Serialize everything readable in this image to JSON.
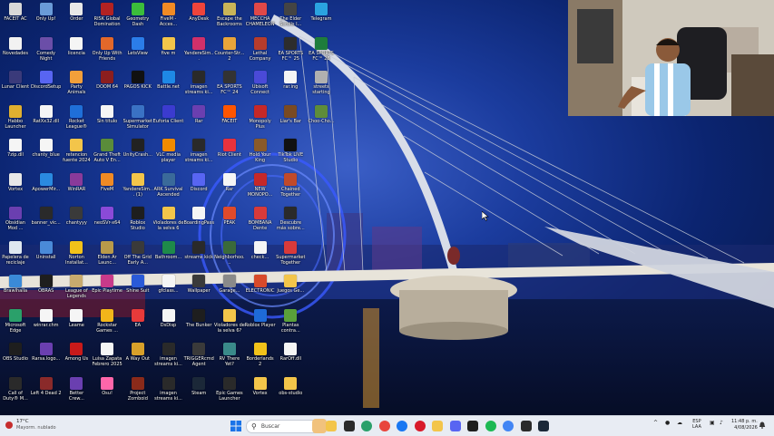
{
  "desktop": {
    "icons": [
      {
        "label": "FACEIT AC",
        "icon": "faceit-ac-icon",
        "color": "#d8d8d8",
        "col": 0,
        "row": 0
      },
      {
        "label": "Only Up!",
        "icon": "only-up-icon",
        "color": "#6a9bd8",
        "col": 1,
        "row": 0
      },
      {
        "label": "Order",
        "icon": "order-icon",
        "color": "#e8e8e8",
        "col": 2,
        "row": 0
      },
      {
        "label": "RISK Global Domination",
        "icon": "risk-icon",
        "color": "#b22222",
        "col": 3,
        "row": 0
      },
      {
        "label": "Geometry Dash",
        "icon": "geometry-dash-icon",
        "color": "#3bbd3b",
        "col": 4,
        "row": 0
      },
      {
        "label": "FiveM - Acces...",
        "icon": "fivem-icon",
        "color": "#f08a24",
        "col": 5,
        "row": 0
      },
      {
        "label": "AnyDesk",
        "icon": "anydesk-icon",
        "color": "#ef443b",
        "col": 6,
        "row": 0
      },
      {
        "label": "Escape the Backrooms",
        "icon": "backrooms-icon",
        "color": "#c9b458",
        "col": 7,
        "row": 0
      },
      {
        "label": "MECCHA CHAMELEON",
        "icon": "meccha-icon",
        "color": "#e04848",
        "col": 8,
        "row": 0
      },
      {
        "label": "The Elder Scrolls I...",
        "icon": "elder-scrolls-icon",
        "color": "#444444",
        "col": 9,
        "row": 0
      },
      {
        "label": "Telegram",
        "icon": "telegram-icon",
        "color": "#2aa3e0",
        "col": 10,
        "row": 0
      },
      {
        "label": "Novedades",
        "icon": "novedades-icon",
        "color": "#f2f2f2",
        "col": 0,
        "row": 1
      },
      {
        "label": "Comedy Night",
        "icon": "comedy-night-icon",
        "color": "#6b4ea8",
        "col": 1,
        "row": 1
      },
      {
        "label": "licencia",
        "icon": "file-icon",
        "color": "#f5f5f5",
        "col": 2,
        "row": 1
      },
      {
        "label": "Only Up With Friends",
        "icon": "only-up-friends-icon",
        "color": "#e3682a",
        "col": 3,
        "row": 1
      },
      {
        "label": "LetsView",
        "icon": "letsview-icon",
        "color": "#2b7de9",
        "col": 4,
        "row": 1
      },
      {
        "label": "five m",
        "icon": "folder-icon",
        "color": "#f3c54a",
        "col": 5,
        "row": 1
      },
      {
        "label": "YandereSim...",
        "icon": "yandere-icon",
        "color": "#d0306a",
        "col": 6,
        "row": 1
      },
      {
        "label": "Counter-Str... 2",
        "icon": "cs2-icon",
        "color": "#e8a43a",
        "col": 7,
        "row": 1
      },
      {
        "label": "Lethal Company",
        "icon": "lethal-company-icon",
        "color": "#b63c2c",
        "col": 8,
        "row": 1
      },
      {
        "label": "EA SPORTS FC™ 25",
        "icon": "eafc-icon",
        "color": "#2d2d2d",
        "col": 9,
        "row": 1
      },
      {
        "label": "EA SPORTS FC™ 25",
        "icon": "eafc-icon",
        "color": "#1e7d3c",
        "col": 10,
        "row": 1
      },
      {
        "label": "Lunar Client",
        "icon": "lunar-client-icon",
        "color": "#3a3a7a",
        "col": 0,
        "row": 2
      },
      {
        "label": "DiscordSetup",
        "icon": "discord-icon",
        "color": "#5865f2",
        "col": 1,
        "row": 2
      },
      {
        "label": "Party Animals",
        "icon": "party-animals-icon",
        "color": "#f29f3a",
        "col": 2,
        "row": 2
      },
      {
        "label": "DOOM 64",
        "icon": "doom-icon",
        "color": "#8b1e1e",
        "col": 3,
        "row": 2
      },
      {
        "label": "PAGOS KICK",
        "icon": "pagos-kick-icon",
        "color": "#111111",
        "col": 4,
        "row": 2
      },
      {
        "label": "Battle.net",
        "icon": "battlenet-icon",
        "color": "#1e88e5",
        "col": 5,
        "row": 2
      },
      {
        "label": "imagen streams ki...",
        "icon": "image-icon",
        "color": "#2a2a2a",
        "col": 6,
        "row": 2
      },
      {
        "label": "EA SPORTS FC™ 24",
        "icon": "eafc-icon",
        "color": "#333333",
        "col": 7,
        "row": 2
      },
      {
        "label": "Ubisoft Connect",
        "icon": "ubisoft-icon",
        "color": "#4a4ad8",
        "col": 8,
        "row": 2
      },
      {
        "label": "rar.ing",
        "icon": "file-icon",
        "color": "#f5f5f5",
        "col": 9,
        "row": 2
      },
      {
        "label": "streets starting",
        "icon": "streets-icon",
        "color": "#b0b0b0",
        "col": 10,
        "row": 2
      },
      {
        "label": "Habbo Launcher",
        "icon": "habbo-icon",
        "color": "#e0b030",
        "col": 0,
        "row": 3
      },
      {
        "label": "RatXx32.dll",
        "icon": "dll-icon",
        "color": "#f5f5f5",
        "col": 1,
        "row": 3
      },
      {
        "label": "Rocket League®",
        "icon": "rocket-league-icon",
        "color": "#1f6fd8",
        "col": 2,
        "row": 3
      },
      {
        "label": "Sin título",
        "icon": "file-icon",
        "color": "#f5f5f5",
        "col": 3,
        "row": 3
      },
      {
        "label": "Supermarket Simulator",
        "icon": "supermarket-icon",
        "color": "#3a72c4",
        "col": 4,
        "row": 3
      },
      {
        "label": "Euforia Client",
        "icon": "euforia-icon",
        "color": "#3b3bcf",
        "col": 5,
        "row": 3
      },
      {
        "label": "Rar",
        "icon": "rar-icon",
        "color": "#6a3fb0",
        "col": 6,
        "row": 3
      },
      {
        "label": "FACEIT",
        "icon": "faceit-icon",
        "color": "#ff5500",
        "col": 7,
        "row": 3
      },
      {
        "label": "Monopoly Plus",
        "icon": "monopoly-icon",
        "color": "#c62828",
        "col": 8,
        "row": 3
      },
      {
        "label": "Liar's Bar",
        "icon": "liars-bar-icon",
        "color": "#7a4a22",
        "col": 9,
        "row": 3
      },
      {
        "label": "Choo-Cho...",
        "icon": "choo-choo-icon",
        "color": "#5e8c3a",
        "col": 10,
        "row": 3
      },
      {
        "label": "7zip.dll",
        "icon": "dll-icon",
        "color": "#f5f5f5",
        "col": 0,
        "row": 4
      },
      {
        "label": "chanty_blue",
        "icon": "file-icon",
        "color": "#f5f5f5",
        "col": 1,
        "row": 4
      },
      {
        "label": "retencion fuente 2024",
        "icon": "folder-icon",
        "color": "#f3c54a",
        "col": 2,
        "row": 4
      },
      {
        "label": "Grand Theft Auto V En...",
        "icon": "gta-icon",
        "color": "#5a8c3a",
        "col": 3,
        "row": 4
      },
      {
        "label": "UnityCrash...",
        "icon": "unity-icon",
        "color": "#222222",
        "col": 4,
        "row": 4
      },
      {
        "label": "VLC media player",
        "icon": "vlc-icon",
        "color": "#f08a00",
        "col": 5,
        "row": 4
      },
      {
        "label": "imagen streams ki...",
        "icon": "image-icon",
        "color": "#2a2a2a",
        "col": 6,
        "row": 4
      },
      {
        "label": "Riot Client",
        "icon": "riot-icon",
        "color": "#e8323c",
        "col": 7,
        "row": 4
      },
      {
        "label": "Hold Your King",
        "icon": "hold-your-king-icon",
        "color": "#8a5a2a",
        "col": 8,
        "row": 4
      },
      {
        "label": "TikTok LIVE Studio",
        "icon": "tiktok-icon",
        "color": "#111111",
        "col": 9,
        "row": 4
      },
      {
        "label": "Vortex",
        "icon": "vortex-icon",
        "color": "#e8e8e8",
        "col": 0,
        "row": 5
      },
      {
        "label": "ApowerMir...",
        "icon": "apowermirror-icon",
        "color": "#2a8ae0",
        "col": 1,
        "row": 5
      },
      {
        "label": "WinRAR",
        "icon": "winrar-icon",
        "color": "#8a3a9a",
        "col": 2,
        "row": 5
      },
      {
        "label": "FiveM",
        "icon": "fivem-icon",
        "color": "#f08a24",
        "col": 3,
        "row": 5
      },
      {
        "label": "YandereSim... (1)",
        "icon": "folder-icon",
        "color": "#f3c54a",
        "col": 4,
        "row": 5
      },
      {
        "label": "ARK Survival Ascended",
        "icon": "ark-icon",
        "color": "#3a6a9a",
        "col": 5,
        "row": 5
      },
      {
        "label": "Discord",
        "icon": "discord-icon",
        "color": "#5865f2",
        "col": 6,
        "row": 5
      },
      {
        "label": "Rar",
        "icon": "file-icon",
        "color": "#f5f5f5",
        "col": 7,
        "row": 5
      },
      {
        "label": "NEW MONOPO...",
        "icon": "monopoly-icon",
        "color": "#c62828",
        "col": 8,
        "row": 5
      },
      {
        "label": "Chained Together",
        "icon": "chained-together-icon",
        "color": "#c04a2a",
        "col": 9,
        "row": 5
      },
      {
        "label": "Obsidian Mod ...",
        "icon": "obsidian-icon",
        "color": "#6a3fb0",
        "col": 0,
        "row": 6
      },
      {
        "label": "banner_vic...",
        "icon": "image-icon",
        "color": "#2a2a2a",
        "col": 1,
        "row": 6
      },
      {
        "label": "chantyyy",
        "icon": "image-icon",
        "color": "#3a3a3a",
        "col": 2,
        "row": 6
      },
      {
        "label": "neoSVr-x64",
        "icon": "neosvr-icon",
        "color": "#8a4ad8",
        "col": 3,
        "row": 6
      },
      {
        "label": "Roblox Studio",
        "icon": "roblox-studio-icon",
        "color": "#1e1e1e",
        "col": 4,
        "row": 6
      },
      {
        "label": "Violadores de la selva 6",
        "icon": "folder-icon",
        "color": "#f3c54a",
        "col": 5,
        "row": 6
      },
      {
        "label": "BoardingPass",
        "icon": "file-icon",
        "color": "#f5f5f5",
        "col": 6,
        "row": 6
      },
      {
        "label": "PEAK",
        "icon": "peak-icon",
        "color": "#e04a2a",
        "col": 7,
        "row": 6
      },
      {
        "label": "BOMBANA Dente",
        "icon": "bombana-icon",
        "color": "#d83a3a",
        "col": 8,
        "row": 6
      },
      {
        "label": "Descubre más sobre...",
        "icon": "spotlight-icon",
        "color": "#2a2a2a",
        "col": 9,
        "row": 6
      },
      {
        "label": "Papelera de reciclaje",
        "icon": "recycle-bin-icon",
        "color": "#dfe8f0",
        "col": 0,
        "row": 7
      },
      {
        "label": "Uninstall",
        "icon": "uninstall-icon",
        "color": "#4a8ad8",
        "col": 1,
        "row": 7
      },
      {
        "label": "Norton Installat...",
        "icon": "norton-icon",
        "color": "#f2c21a",
        "col": 2,
        "row": 7
      },
      {
        "label": "Elden Ar Launc...",
        "icon": "elden-ring-icon",
        "color": "#b89a4a",
        "col": 3,
        "row": 7
      },
      {
        "label": "Off The Grid Early A...",
        "icon": "off-the-grid-icon",
        "color": "#3a3a3a",
        "col": 4,
        "row": 7
      },
      {
        "label": "Bathroom...",
        "icon": "bathroom-icon",
        "color": "#1e8a4a",
        "col": 5,
        "row": 7
      },
      {
        "label": "streams kick",
        "icon": "image-icon",
        "color": "#2a2a2a",
        "col": 6,
        "row": 7
      },
      {
        "label": "Neighborhoo...",
        "icon": "neighborhood-icon",
        "color": "#3a6a3a",
        "col": 7,
        "row": 7
      },
      {
        "label": "check...",
        "icon": "file-icon",
        "color": "#f5f5f5",
        "col": 8,
        "row": 7
      },
      {
        "label": "Supermarket Together",
        "icon": "supermarket-together-icon",
        "color": "#d83a3a",
        "col": 9,
        "row": 7
      },
      {
        "label": "Brawlhalla",
        "icon": "brawlhalla-icon",
        "color": "#3a8ad8",
        "col": 0,
        "row": 8
      },
      {
        "label": "OBRAS",
        "icon": "obs-icon",
        "color": "#1e1e1e",
        "col": 1,
        "row": 8
      },
      {
        "label": "League of Legends",
        "icon": "league-icon",
        "color": "#c8aa6e",
        "col": 2,
        "row": 8
      },
      {
        "label": "Epic Playtime",
        "icon": "epic-playtime-icon",
        "color": "#c83a8a",
        "col": 3,
        "row": 8
      },
      {
        "label": "Shine Suit",
        "icon": "shine-suit-icon",
        "color": "#2a5ad8",
        "col": 4,
        "row": 8
      },
      {
        "label": "gfclass...",
        "icon": "file-icon",
        "color": "#f5f5f5",
        "col": 5,
        "row": 8
      },
      {
        "label": "Wallpaper",
        "icon": "image-icon",
        "color": "#3a3a3a",
        "col": 6,
        "row": 8
      },
      {
        "label": "Garage...",
        "icon": "garage-icon",
        "color": "#8a8a8a",
        "col": 7,
        "row": 8
      },
      {
        "label": "ELECTRONIC",
        "icon": "electronic-icon",
        "color": "#d84a2a",
        "col": 8,
        "row": 8
      },
      {
        "label": "Juegos Ge...",
        "icon": "folder-icon",
        "color": "#f3c54a",
        "col": 9,
        "row": 8
      },
      {
        "label": "Microsoft Edge",
        "icon": "edge-icon",
        "color": "#2aa06a",
        "col": 0,
        "row": 9
      },
      {
        "label": "winrar.chm",
        "icon": "file-icon",
        "color": "#f5f5f5",
        "col": 1,
        "row": 9
      },
      {
        "label": "Leame",
        "icon": "file-icon",
        "color": "#f5f5f5",
        "col": 2,
        "row": 9
      },
      {
        "label": "Rockstar Games ...",
        "icon": "rockstar-icon",
        "color": "#f2b51a",
        "col": 3,
        "row": 9
      },
      {
        "label": "EA",
        "icon": "ea-icon",
        "color": "#e83a3a",
        "col": 4,
        "row": 9
      },
      {
        "label": "DsDisp",
        "icon": "file-icon",
        "color": "#f5f5f5",
        "col": 5,
        "row": 9
      },
      {
        "label": "The Bunker",
        "icon": "bunker-icon",
        "color": "#1e1e1e",
        "col": 6,
        "row": 9
      },
      {
        "label": "Violadores de la selva 6?",
        "icon": "folder-icon",
        "color": "#f3c54a",
        "col": 7,
        "row": 9
      },
      {
        "label": "Roblox Player",
        "icon": "roblox-icon",
        "color": "#1e6ad8",
        "col": 8,
        "row": 9
      },
      {
        "label": "Plantas contra...",
        "icon": "pvz-icon",
        "color": "#5aa03a",
        "col": 9,
        "row": 9
      },
      {
        "label": "OBS Studio",
        "icon": "obs-icon",
        "color": "#1e1e1e",
        "col": 0,
        "row": 10
      },
      {
        "label": "Rarsa.logo...",
        "icon": "rar-icon",
        "color": "#6a3fb0",
        "col": 1,
        "row": 10
      },
      {
        "label": "Among Us",
        "icon": "among-us-icon",
        "color": "#c81a1a",
        "col": 2,
        "row": 10
      },
      {
        "label": "Luisa Zapata Febrero 2025",
        "icon": "file-icon",
        "color": "#f5f5f5",
        "col": 3,
        "row": 10
      },
      {
        "label": "A Way Out",
        "icon": "a-way-out-icon",
        "color": "#d8a02a",
        "col": 4,
        "row": 10
      },
      {
        "label": "imagen streams ki...",
        "icon": "image-icon",
        "color": "#2a2a2a",
        "col": 5,
        "row": 10
      },
      {
        "label": "TRIGGERcmd Agent",
        "icon": "triggercmd-icon",
        "color": "#3a3a3a",
        "col": 6,
        "row": 10
      },
      {
        "label": "RV There Yet?",
        "icon": "rv-icon",
        "color": "#3a8a8a",
        "col": 7,
        "row": 10
      },
      {
        "label": "Borderlands 2",
        "icon": "borderlands-icon",
        "color": "#f2c21a",
        "col": 8,
        "row": 10
      },
      {
        "label": "RarOff.dll",
        "icon": "dll-icon",
        "color": "#f5f5f5",
        "col": 9,
        "row": 10
      },
      {
        "label": "Call of Duty® M...",
        "icon": "cod-icon",
        "color": "#2a2a2a",
        "col": 0,
        "row": 11
      },
      {
        "label": "Left 4 Dead 2",
        "icon": "l4d2-icon",
        "color": "#8a2a2a",
        "col": 1,
        "row": 11
      },
      {
        "label": "Better Crew...",
        "icon": "better-crew-icon",
        "color": "#6a3fb0",
        "col": 2,
        "row": 11
      },
      {
        "label": "Osu!",
        "icon": "osu-icon",
        "color": "#ff66aa",
        "col": 3,
        "row": 11
      },
      {
        "label": "Project Zomboid",
        "icon": "zomboid-icon",
        "color": "#8a2a1a",
        "col": 4,
        "row": 11
      },
      {
        "label": "imagen streams ki...",
        "icon": "image-icon",
        "color": "#2a2a2a",
        "col": 5,
        "row": 11
      },
      {
        "label": "Steam",
        "icon": "steam-icon",
        "color": "#1b2838",
        "col": 6,
        "row": 11
      },
      {
        "label": "Epic Games Launcher",
        "icon": "epic-games-icon",
        "color": "#2a2a2a",
        "col": 7,
        "row": 11
      },
      {
        "label": "Vortex",
        "icon": "folder-icon",
        "color": "#f3c54a",
        "col": 8,
        "row": 11
      },
      {
        "label": "obs-studio",
        "icon": "folder-icon",
        "color": "#f3c54a",
        "col": 9,
        "row": 11
      }
    ]
  },
  "taskbar": {
    "weather_temp": "17°C",
    "weather_desc": "Mayorm. nublado",
    "search_placeholder": "Buscar",
    "pinned": [
      {
        "icon": "file-explorer-icon",
        "color": "#f3c54a"
      },
      {
        "icon": "store-icon",
        "color": "#2a2a2a"
      },
      {
        "icon": "edge-icon",
        "color": "#2aa06a"
      },
      {
        "icon": "chrome-icon",
        "color": "#e8453c"
      },
      {
        "icon": "facebook-icon",
        "color": "#1877f2"
      },
      {
        "icon": "opera-icon",
        "color": "#d81a2a"
      },
      {
        "icon": "folder-icon",
        "color": "#f3c54a"
      },
      {
        "icon": "discord-icon",
        "color": "#5865f2"
      },
      {
        "icon": "terminal-icon",
        "color": "#1e1e1e"
      },
      {
        "icon": "spotify-icon",
        "color": "#1db954"
      },
      {
        "icon": "chrome-icon",
        "color": "#4285f4"
      },
      {
        "icon": "obs-icon",
        "color": "#2a2a2a"
      },
      {
        "icon": "steam-icon",
        "color": "#1b2838"
      }
    ],
    "language_line1": "ESP",
    "language_line2": "LAA",
    "time": "11:48 p. m.",
    "date": "4/08/2026"
  }
}
